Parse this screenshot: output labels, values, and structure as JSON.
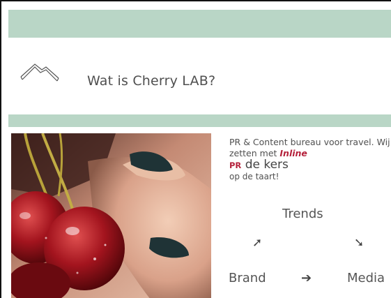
{
  "header": {
    "title": "Wat is Cherry LAB?",
    "icon": "home-outline-icon"
  },
  "intro": {
    "line1": "PR & Content bureau voor travel. Wij zetten met ",
    "inline_word": "Inline",
    "pr_word": "PR",
    "kers_phrase": " de kers",
    "line_end": "op de taart!"
  },
  "diagram": {
    "top_label": "Trends",
    "left_label": "Brand",
    "right_label": "Media",
    "arrow_ne": "➚",
    "arrow_se": "➘",
    "arrow_right": "➔"
  },
  "colors": {
    "band": "#b9d6c6",
    "accent": "#b5223c",
    "text": "#505050"
  }
}
